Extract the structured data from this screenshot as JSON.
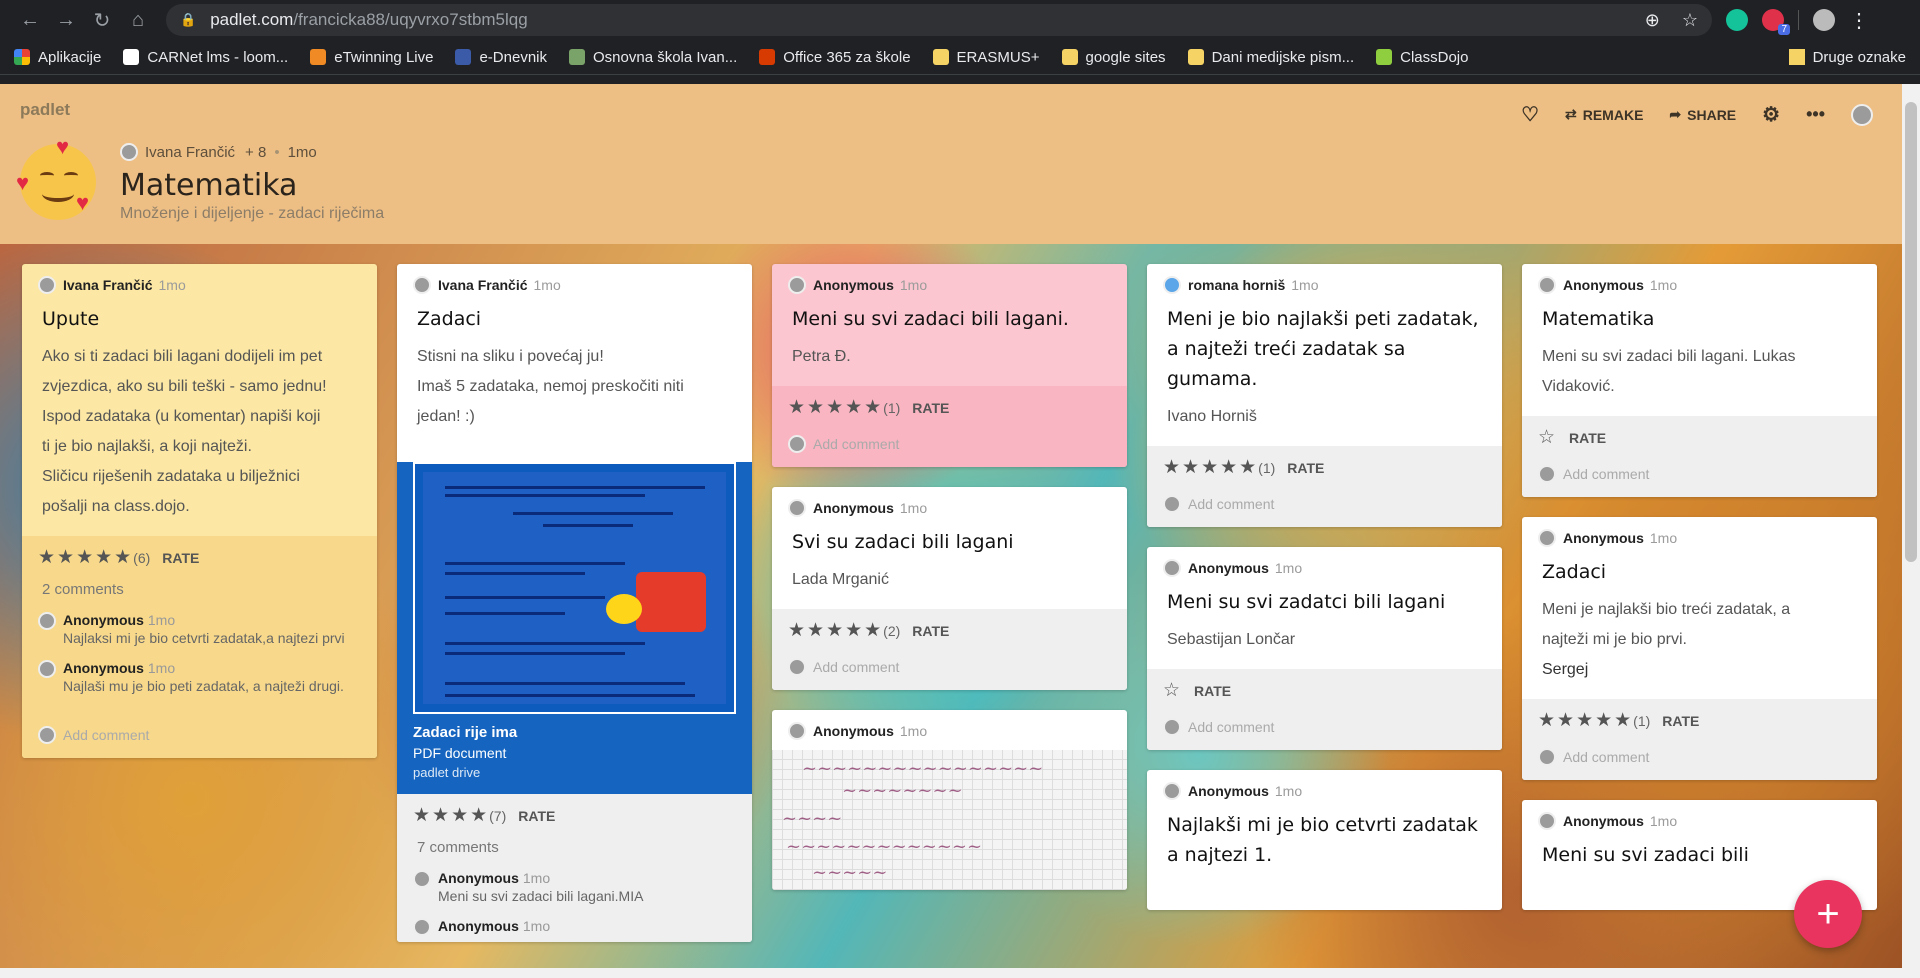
{
  "browser": {
    "domain": "padlet.com",
    "path": "/francicka88/uqyvrxo7stbm5lqg",
    "ext_badge": "7",
    "bookmarks": [
      "Aplikacije",
      "CARNet lms - loom...",
      "eTwinning Live",
      "e-Dnevnik",
      "Osnovna škola Ivan...",
      "Office 365 za škole",
      "ERASMUS+",
      "google sites",
      "Dani medijske pism...",
      "ClassDojo"
    ],
    "other_bookmarks": "Druge oznake"
  },
  "header": {
    "brand": "padlet",
    "author": "Ivana Frančić",
    "plus": "+ 8",
    "dot": "•",
    "age": "1mo",
    "title": "Matematika",
    "subtitle": "Množenje i dijeljenje - zadaci riječima",
    "remake": "REMAKE",
    "share": "SHARE"
  },
  "cards": {
    "c1": {
      "author": "Ivana Frančić",
      "time": "1mo",
      "title": "Upute",
      "body": [
        "Ako si ti zadaci bili lagani dodijeli im pet",
        "zvjezdica, ako su bili teški - samo jednu!",
        "Ispod zadataka (u komentar) napiši koji",
        "ti je bio najlakši, a koji najteži.",
        "Sličicu riješenih zadataka u bilježnici",
        "pošalji na class.dojo."
      ],
      "stars": "★★★★★",
      "count": "(6)",
      "rate": "RATE",
      "comments_label": "2 comments",
      "comments": [
        {
          "name": "Anonymous",
          "time": "1mo",
          "text": "Najlaksi mi je bio cetvrti zadatak,a najtezi prvi"
        },
        {
          "name": "Anonymous",
          "time": "1mo",
          "text": "Najlaši mu je bio peti zadatak, a najteži drugi."
        }
      ],
      "add": "Add comment"
    },
    "c2": {
      "author": "Ivana Frančić",
      "time": "1mo",
      "title": "Zadaci",
      "body": [
        "Stisni na sliku i povećaj ju!",
        "Imaš 5 zadataka, nemoj preskočiti niti",
        "jedan! :)"
      ],
      "pdf_title": "Zadaci rije ima",
      "pdf_type": "PDF document",
      "pdf_source": "padlet drive",
      "stars": "★★★★",
      "count": "(7)",
      "rate": "RATE",
      "comments_label": "7 comments",
      "comments": [
        {
          "name": "Anonymous",
          "time": "1mo",
          "text": "Meni su svi zadaci bili lagani.MIA"
        },
        {
          "name": "Anonymous",
          "time": "1mo",
          "text": ""
        }
      ]
    },
    "c3": {
      "author": "Anonymous",
      "time": "1mo",
      "title": "Meni su svi zadaci bili lagani.",
      "body": "Petra Đ.",
      "stars": "★★★★★",
      "count": "(1)",
      "rate": "RATE",
      "add": "Add comment"
    },
    "c4": {
      "author": "Anonymous",
      "time": "1mo",
      "title": "Svi su zadaci bili lagani",
      "body": "Lada Mrganić",
      "stars": "★★★★★",
      "count": "(2)",
      "rate": "RATE",
      "add": "Add comment"
    },
    "c5": {
      "author": "Anonymous",
      "time": "1mo"
    },
    "c6": {
      "author": "romana horniš",
      "time": "1mo",
      "title": "Meni je bio najlakši peti zadatak, a najteži treći zadatak sa gumama.",
      "body": "Ivano Horniš",
      "stars": "★★★★★",
      "count": "(1)",
      "rate": "RATE",
      "add": "Add comment"
    },
    "c7": {
      "author": "Anonymous",
      "time": "1mo",
      "title": "Meni su svi zadatci bili lagani",
      "body": "Sebastijan Lončar",
      "stars": "☆",
      "rate": "RATE",
      "add": "Add comment"
    },
    "c8": {
      "author": "Anonymous",
      "time": "1mo",
      "title": "Najlakši mi je bio cetvrti zadatak a najtezi 1."
    },
    "c9": {
      "author": "Anonymous",
      "time": "1mo",
      "title": "Matematika",
      "body": "Meni su svi zadaci bili lagani. Lukas Vidaković.",
      "stars": "☆",
      "rate": "RATE",
      "add": "Add comment"
    },
    "c10": {
      "author": "Anonymous",
      "time": "1mo",
      "title": "Zadaci",
      "body": [
        "Meni je najlakši bio treći zadatak, a",
        "najteži mi je bio prvi.",
        "Sergej"
      ],
      "stars": "★★★★★",
      "count": "(1)",
      "rate": "RATE",
      "add": "Add comment"
    },
    "c11": {
      "author": "Anonymous",
      "time": "1mo",
      "title": "Meni su svi zadaci bili"
    }
  },
  "fab": "+"
}
